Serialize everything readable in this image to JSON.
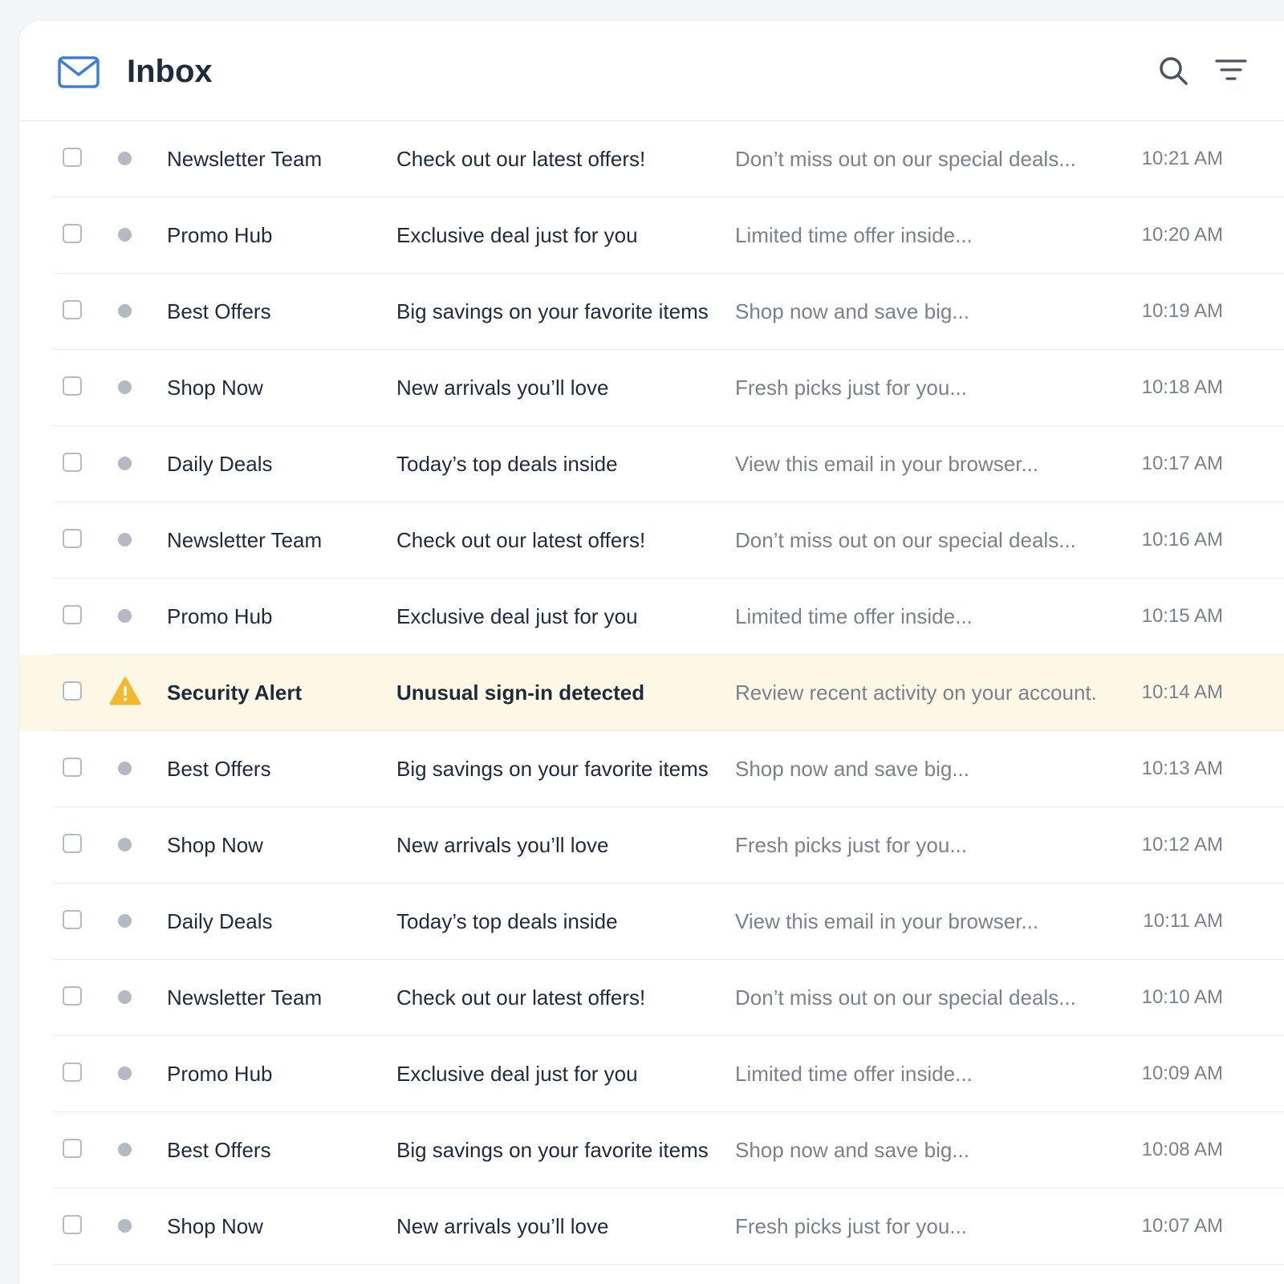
{
  "header": {
    "title": "Inbox",
    "icons": {
      "mail": "mail-icon",
      "search": "search-icon",
      "filter": "filter-icon"
    }
  },
  "colors": {
    "accent": "#3b7fd6",
    "alert_row": "#fdf8e6",
    "alert_icon": "#f4b82a"
  },
  "emails": [
    {
      "sender": "Newsletter Team",
      "subject": "Check out our latest offers!",
      "preview": "Don’t miss out on our special deals...",
      "time": "10:21 AM",
      "alert": false
    },
    {
      "sender": "Promo Hub",
      "subject": "Exclusive deal just for you",
      "preview": "Limited time offer inside...",
      "time": "10:20 AM",
      "alert": false
    },
    {
      "sender": "Best Offers",
      "subject": "Big savings on your favorite items",
      "preview": "Shop now and save big...",
      "time": "10:19 AM",
      "alert": false
    },
    {
      "sender": "Shop Now",
      "subject": "New arrivals you’ll love",
      "preview": "Fresh picks just for you...",
      "time": "10:18 AM",
      "alert": false
    },
    {
      "sender": "Daily Deals",
      "subject": "Today’s top deals inside",
      "preview": "View this email in your browser...",
      "time": "10:17 AM",
      "alert": false
    },
    {
      "sender": "Newsletter Team",
      "subject": "Check out our latest offers!",
      "preview": "Don’t miss out on our special deals...",
      "time": "10:16 AM",
      "alert": false
    },
    {
      "sender": "Promo Hub",
      "subject": "Exclusive deal just for you",
      "preview": "Limited time offer inside...",
      "time": "10:15 AM",
      "alert": false
    },
    {
      "sender": "Security Alert",
      "subject": "Unusual sign-in detected",
      "preview": "Review recent activity on your account.",
      "time": "10:14 AM",
      "alert": true
    },
    {
      "sender": "Best Offers",
      "subject": "Big savings on your favorite items",
      "preview": "Shop now and save big...",
      "time": "10:13 AM",
      "alert": false
    },
    {
      "sender": "Shop Now",
      "subject": "New arrivals you’ll love",
      "preview": "Fresh picks just for you...",
      "time": "10:12 AM",
      "alert": false
    },
    {
      "sender": "Daily Deals",
      "subject": "Today’s top deals inside",
      "preview": "View this email in your browser...",
      "time": "10:11 AM",
      "alert": false
    },
    {
      "sender": "Newsletter Team",
      "subject": "Check out our latest offers!",
      "preview": "Don’t miss out on our special deals...",
      "time": "10:10 AM",
      "alert": false
    },
    {
      "sender": "Promo Hub",
      "subject": "Exclusive deal just for you",
      "preview": "Limited time offer inside...",
      "time": "10:09 AM",
      "alert": false
    },
    {
      "sender": "Best Offers",
      "subject": "Big savings on your favorite items",
      "preview": "Shop now and save big...",
      "time": "10:08 AM",
      "alert": false
    },
    {
      "sender": "Shop Now",
      "subject": "New arrivals you’ll love",
      "preview": "Fresh picks just for you...",
      "time": "10:07 AM",
      "alert": false
    }
  ]
}
